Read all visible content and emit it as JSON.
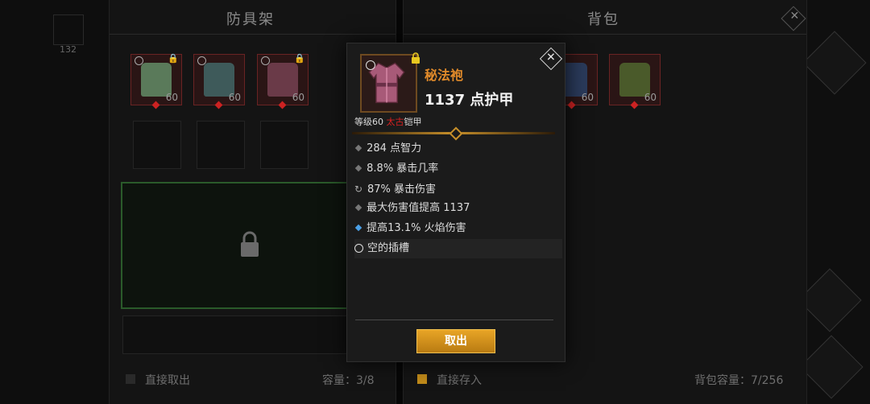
{
  "left_panel": {
    "title": "防具架"
  },
  "right_panel": {
    "title": "背包"
  },
  "left_items": [
    {
      "name": "green-boots",
      "level": "60",
      "color": "#5a7a5a",
      "locked": true
    },
    {
      "name": "green-robe",
      "level": "60",
      "color": "#3e5a5a",
      "locked": false
    },
    {
      "name": "red-robe",
      "level": "60",
      "color": "#6a3a48",
      "locked": true
    }
  ],
  "right_items": [
    {
      "name": "blue-armor",
      "level": "60",
      "color": "#2a3a5a"
    },
    {
      "name": "green-boots",
      "level": "60",
      "color": "#4a5a2a"
    }
  ],
  "side_badge": "132",
  "left_bottom": {
    "checkbox_label": "直接取出",
    "capacity": "容量：3/8"
  },
  "right_bottom": {
    "checkbox_label": "直接存入",
    "capacity": "背包容量：7/256"
  },
  "dialog": {
    "item_name": "秘法袍",
    "armor_value": "1137 点护甲",
    "level_prefix": "等级60 ",
    "level_tag": "太古",
    "level_suffix": "铠甲",
    "stats": [
      {
        "text": "284 点智力",
        "icon": "diamond-bullet"
      },
      {
        "text": "8.8% 暴击几率",
        "icon": "diamond-bullet"
      },
      {
        "text": "87% 暴击伤害",
        "icon": "reroll-icon"
      },
      {
        "text": "最大伤害值提高 1137",
        "icon": "diamond-bullet"
      },
      {
        "text": "提高13.1% 火焰伤害",
        "icon": "blue-diamond-bullet"
      },
      {
        "text": "空的插槽",
        "icon": "empty-socket-icon"
      }
    ],
    "button_label": "取出"
  },
  "colors": {
    "accent": "#e08a2a",
    "button": "#d99a20",
    "ancient": "#d82020",
    "magic": "#4aa0e8"
  }
}
